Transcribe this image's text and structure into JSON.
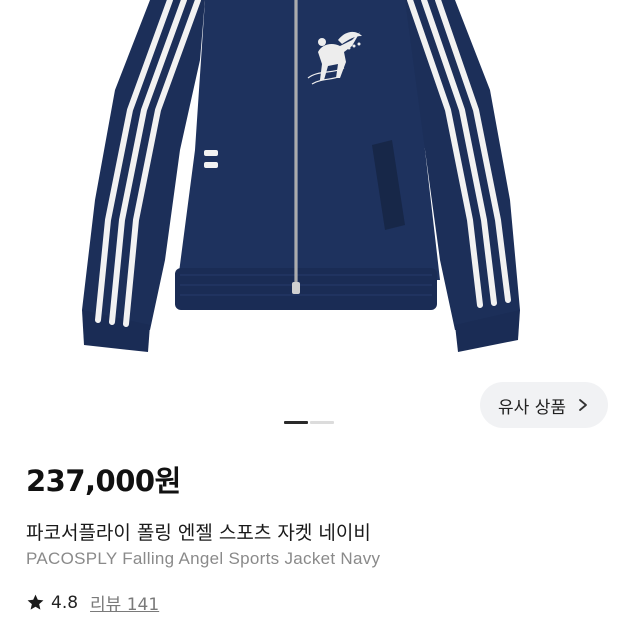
{
  "product": {
    "image_alt": "PACOSPLY Falling Angel Sports Jacket Navy",
    "similar_button_label": "유사 상품",
    "gallery": {
      "total_images": 2,
      "current_index": 1
    },
    "price": "237,000원",
    "title_ko": "파코서플라이 폴링 엔젤 스포츠 자켓 네이비",
    "title_en": "PACOSPLY Falling Angel Sports Jacket Navy",
    "rating": "4.8",
    "review_label": "리뷰 141"
  },
  "colors": {
    "jacket_navy": "#1c2f59",
    "stripe_white": "#f2f2f2",
    "price_text": "#111111",
    "subtitle_text": "#8a8a8a",
    "button_bg": "#f1f2f4"
  },
  "icons": {
    "chevron": "chevron-right-icon",
    "star": "star-icon"
  }
}
